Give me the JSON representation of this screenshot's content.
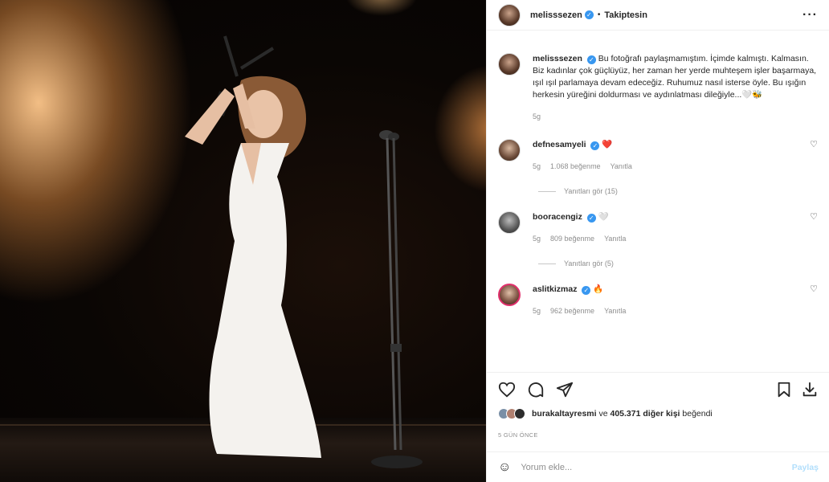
{
  "post": {
    "username": "melisssezen",
    "follow_status": "Takiptesin",
    "more": "···"
  },
  "caption": {
    "username": "melisssezen",
    "text": "Bu fotoğrafı paylaşmamıştım. İçimde kalmıştı. Kalmasın.\nBiz kadınlar çok güçlüyüz, her zaman her yerde muhteşem işler başarmaya, ışıl ışıl parlamaya devam edeceğiz. Ruhumuz nasıl isterse öyle. Bu ışığın herkesin yüreğini doldurması ve aydınlatması dileğiyle...🤍🐝",
    "time": "5g"
  },
  "comments": [
    {
      "username": "defnesamyeli",
      "text": "❤️",
      "time": "5g",
      "likes": "1.068 beğenme",
      "reply": "Yanıtla",
      "view_replies": "Yanıtları gör (15)"
    },
    {
      "username": "booracengiz",
      "text": "🤍",
      "time": "5g",
      "likes": "809 beğenme",
      "reply": "Yanıtla",
      "view_replies": "Yanıtları gör (5)"
    },
    {
      "username": "aslitkizmaz",
      "text": "🔥",
      "time": "5g",
      "likes": "962 beğenme",
      "reply": "Yanıtla"
    }
  ],
  "liked_by": {
    "user": "burakaltayresmi",
    "connector": "ve",
    "others": "405.371 diğer kişi",
    "suffix": "beğendi"
  },
  "date": "5 GÜN ÖNCE",
  "composer": {
    "placeholder": "Yorum ekle...",
    "post": "Paylaş"
  },
  "icons": {
    "like": "heart-icon",
    "comment": "comment-icon",
    "share": "send-icon",
    "save": "bookmark-icon",
    "download": "download-icon",
    "emoji": "emoji-icon"
  },
  "colors": {
    "verified": "#3897f0",
    "heart_red": "#ed4956",
    "post_button_disabled": "#b2dffc"
  }
}
